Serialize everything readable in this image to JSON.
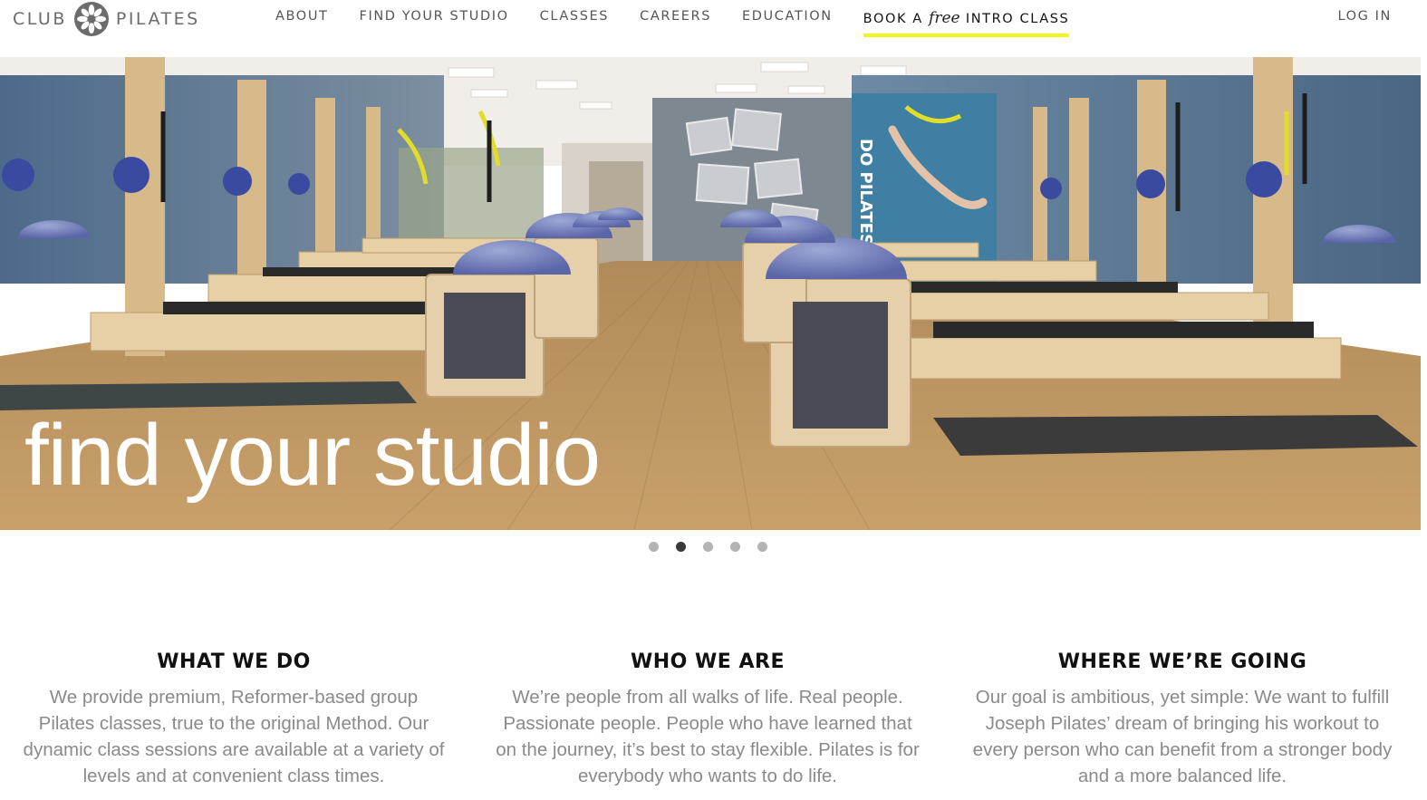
{
  "header": {
    "logo_left": "CLUB",
    "logo_right": "PILATES",
    "logo_icon": "flower-logo-icon",
    "nav": [
      {
        "label": "ABOUT"
      },
      {
        "label": "FIND YOUR STUDIO"
      },
      {
        "label": "CLASSES"
      },
      {
        "label": "CAREERS"
      },
      {
        "label": "EDUCATION"
      }
    ],
    "cta": {
      "before": "BOOK A",
      "script": "free",
      "after": "INTRO CLASS",
      "underline_color": "#f2f51d"
    },
    "login_label": "LOG IN"
  },
  "hero": {
    "caption": "find your studio",
    "slides_total": 5,
    "active_slide": 2
  },
  "columns": [
    {
      "title": "WHAT WE DO",
      "body": "We provide premium, Reformer-based group Pilates classes, true to the original Method. Our dynamic class sessions are available at a variety of levels and at convenient class times."
    },
    {
      "title": "WHO WE ARE",
      "body": "We’re people from all walks of life. Real people. Passionate people. People who have learned that on the journey, it’s best to stay flexible. Pilates is for everybody who wants to do life."
    },
    {
      "title": "WHERE WE’RE GOING",
      "body": "Our goal is ambitious, yet simple: We want to fulfill Joseph Pilates’ dream of bringing his workout to every person who can benefit from a stronger body and a more balanced life."
    }
  ],
  "colors": {
    "accent_yellow": "#f2f51d",
    "nav_text": "#555555",
    "body_text": "#8a8a8a",
    "heading_text": "#111111"
  }
}
